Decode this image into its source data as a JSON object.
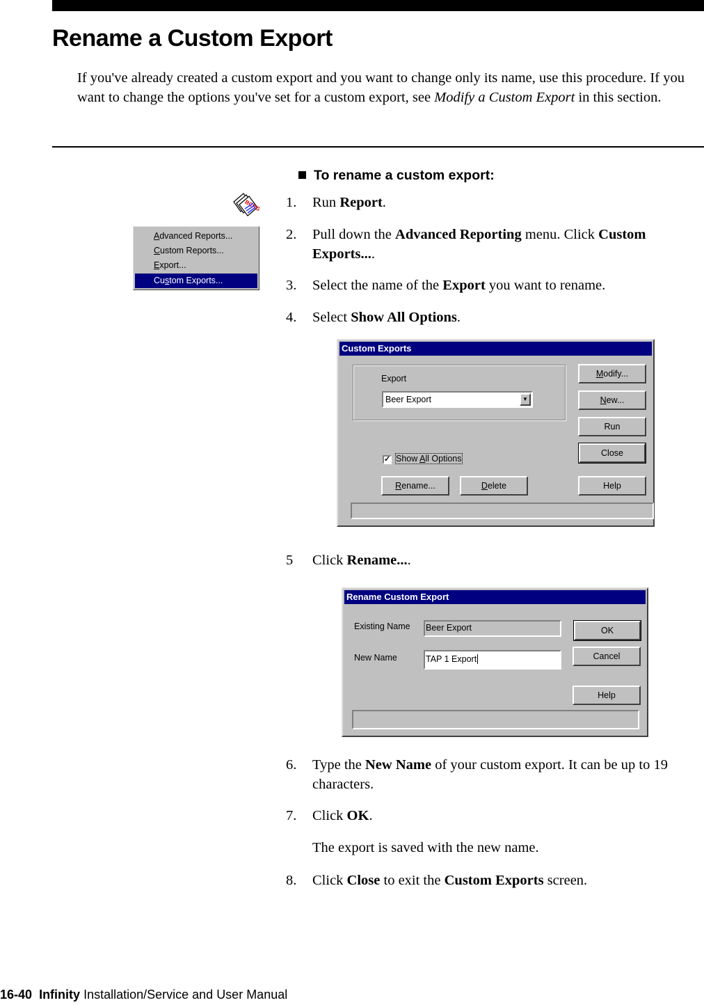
{
  "page": {
    "title": "Rename a Custom Export",
    "intro": {
      "text_before": "If you've already created a custom export and you want to change only its name, use this procedure. If you want to change the options you've set for a custom export, see ",
      "link_italic": "Modify a Custom Export",
      "text_after": " in this section."
    },
    "procedure_heading": "To rename a custom export:",
    "steps": [
      {
        "num": "1.",
        "parts": [
          {
            "t": "Run "
          },
          {
            "b": "Report"
          },
          {
            "t": "."
          }
        ]
      },
      {
        "num": "2.",
        "parts": [
          {
            "t": "Pull down the "
          },
          {
            "b": "Advanced Reporting"
          },
          {
            "t": " menu. Click "
          },
          {
            "b": "Custom Exports..."
          },
          {
            "t": "."
          }
        ]
      },
      {
        "num": "3.",
        "parts": [
          {
            "t": "Select the name of the "
          },
          {
            "b": "Export"
          },
          {
            "t": " you want to rename."
          }
        ]
      },
      {
        "num": "4.",
        "parts": [
          {
            "t": "Select "
          },
          {
            "b": "Show All Options"
          },
          {
            "t": "."
          }
        ]
      },
      {
        "num": "5",
        "parts": [
          {
            "t": "Click "
          },
          {
            "b": "Rename..."
          },
          {
            "t": "."
          }
        ]
      },
      {
        "num": "6.",
        "parts": [
          {
            "t": "Type the "
          },
          {
            "b": "New Name"
          },
          {
            "t": " of your custom export. It can be up to 19 characters."
          }
        ]
      },
      {
        "num": "7.",
        "parts": [
          {
            "t": "Click "
          },
          {
            "b": "OK"
          },
          {
            "t": "."
          }
        ]
      },
      {
        "num": "8.",
        "parts": [
          {
            "t": "Click "
          },
          {
            "b": "Close"
          },
          {
            "t": " to exit the "
          },
          {
            "b": "Custom Exports"
          },
          {
            "t": " screen."
          }
        ]
      }
    ],
    "step7_note": "The export is saved with the new name.",
    "footer": {
      "page_num": "16-40",
      "product": "Infinity",
      "manual": "Installation/Service and User Manual"
    }
  },
  "icons": {
    "report": "report-icon"
  },
  "menu": {
    "items": [
      {
        "pre": "",
        "u": "A",
        "post": "dvanced Reports...",
        "selected": false
      },
      {
        "pre": "",
        "u": "C",
        "post": "ustom Reports...",
        "selected": false
      },
      {
        "pre": "",
        "u": "E",
        "post": "xport...",
        "selected": false
      },
      {
        "pre": "Cu",
        "u": "s",
        "post": "tom Exports...",
        "selected": true
      }
    ]
  },
  "custom_exports_dialog": {
    "title": "Custom Exports",
    "export_label": "Export",
    "export_value": "Beer Export",
    "show_all_options": {
      "pre": "Show ",
      "u": "A",
      "post": "ll Options",
      "checked": true
    },
    "buttons": {
      "modify": {
        "u": "M",
        "post": "odify..."
      },
      "new": {
        "u": "N",
        "post": "ew..."
      },
      "run": "Run",
      "close": "Close",
      "help": "Help",
      "rename": {
        "u": "R",
        "post": "ename..."
      },
      "delete": {
        "u": "D",
        "post": "elete"
      }
    },
    "status": ""
  },
  "rename_dialog": {
    "title": "Rename Custom Export",
    "existing_label": "Existing Name",
    "existing_value": "Beer Export",
    "new_label": "New Name",
    "new_value": "TAP 1 Export",
    "buttons": {
      "ok": "OK",
      "cancel": "Cancel",
      "help": "Help"
    },
    "status": ""
  },
  "colors": {
    "titlebar": "#000080",
    "dialog_bg": "#c0c0c0"
  }
}
